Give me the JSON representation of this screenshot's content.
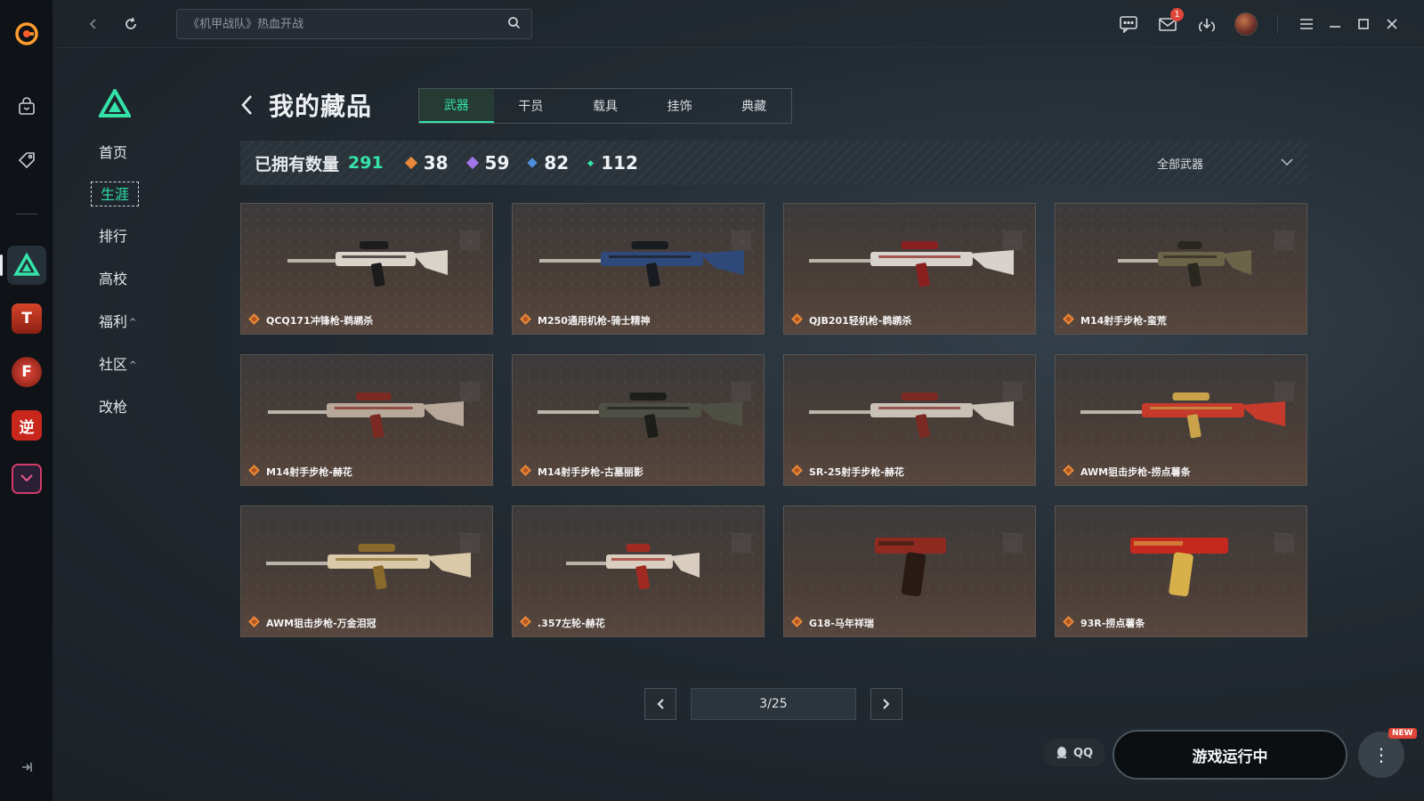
{
  "topbar": {
    "search_placeholder": "《机甲战队》热血开战",
    "mail_badge": "1"
  },
  "subnav": {
    "items": [
      {
        "label": "首页"
      },
      {
        "label": "生涯"
      },
      {
        "label": "排行"
      },
      {
        "label": "高校"
      },
      {
        "label": "福利",
        "caret": "^"
      },
      {
        "label": "社区",
        "caret": "^"
      },
      {
        "label": "改枪"
      }
    ],
    "active_index": 1
  },
  "page": {
    "title": "我的藏品",
    "tabs": [
      "武器",
      "干员",
      "载具",
      "挂饰",
      "典藏"
    ],
    "active_tab": 0
  },
  "stats": {
    "owned_label": "已拥有数量",
    "owned_total": "291",
    "tiers": [
      {
        "value": "38",
        "color": "#e8883a"
      },
      {
        "value": "59",
        "color": "#a276e8"
      },
      {
        "value": "82",
        "color": "#4f8fe0"
      },
      {
        "value": "112",
        "color": "#35e3a9"
      }
    ],
    "filter_label": "全部武器"
  },
  "weapons": [
    {
      "name": "QCQ171冲锋枪-鹈鹕杀",
      "kind": "smg"
    },
    {
      "name": "M250通用机枪-骑士精神",
      "kind": "lmg"
    },
    {
      "name": "QJB201轻机枪-鹈鹕杀",
      "kind": "lmg2"
    },
    {
      "name": "M14射手步枪-蛮荒",
      "kind": "rifle"
    },
    {
      "name": "M14射手步枪-赫花",
      "kind": "rifle2"
    },
    {
      "name": "M14射手步枪-古墓丽影",
      "kind": "rifle3"
    },
    {
      "name": "SR-25射手步枪-赫花",
      "kind": "rifle4"
    },
    {
      "name": "AWM狙击步枪-捞点薯条",
      "kind": "sniper"
    },
    {
      "name": "AWM狙击步枪-万金泪冠",
      "kind": "sniper2"
    },
    {
      "name": ".357左轮-赫花",
      "kind": "revolver"
    },
    {
      "name": "G18-马年祥瑞",
      "kind": "pistol"
    },
    {
      "name": "93R-捞点薯条",
      "kind": "pistol2"
    }
  ],
  "pager": {
    "current": "3/25"
  },
  "bottom": {
    "qq_label": "QQ",
    "launch_label": "游戏运行中",
    "new_tag": "NEW"
  },
  "colors": {
    "accent": "#35e3a9",
    "rarity_orange": "#e8883a"
  }
}
